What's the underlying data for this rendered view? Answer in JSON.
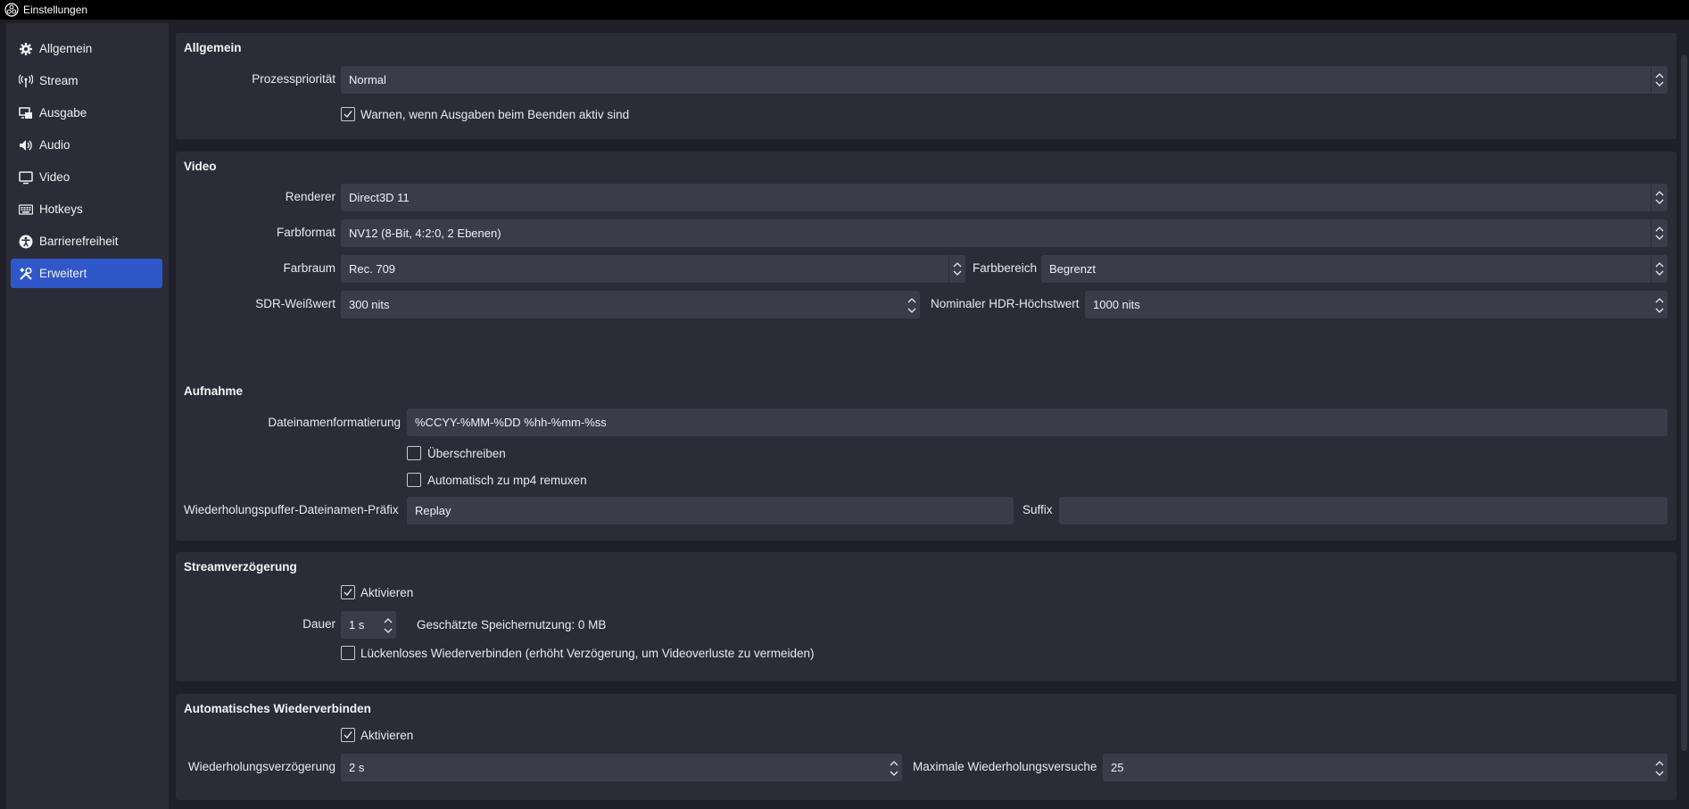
{
  "window": {
    "title": "Einstellungen"
  },
  "sidebar": {
    "items": [
      {
        "label": "Allgemein",
        "icon": "gear-icon"
      },
      {
        "label": "Stream",
        "icon": "antenna-icon"
      },
      {
        "label": "Ausgabe",
        "icon": "output-icon"
      },
      {
        "label": "Audio",
        "icon": "speaker-icon"
      },
      {
        "label": "Video",
        "icon": "monitor-icon"
      },
      {
        "label": "Hotkeys",
        "icon": "keyboard-icon"
      },
      {
        "label": "Barrierefreiheit",
        "icon": "accessibility-icon"
      },
      {
        "label": "Erweitert",
        "icon": "tools-icon",
        "active": true
      }
    ],
    "accent_color": "#2f57c7"
  },
  "general": {
    "title": "Allgemein",
    "priority_label": "Prozesspriorität",
    "priority_value": "Normal",
    "warn_label": "Warnen, wenn Ausgaben beim Beenden aktiv sind",
    "warn_checked": true
  },
  "video": {
    "title": "Video",
    "renderer_label": "Renderer",
    "renderer_value": "Direct3D 11",
    "color_format_label": "Farbformat",
    "color_format_value": "NV12 (8-Bit, 4:2:0, 2 Ebenen)",
    "color_space_label": "Farbraum",
    "color_space_value": "Rec. 709",
    "color_range_label": "Farbbereich",
    "color_range_value": "Begrenzt",
    "sdr_label": "SDR-Weißwert",
    "sdr_value": "300 nits",
    "hdr_label": "Nominaler HDR-Höchstwert",
    "hdr_value": "1000 nits"
  },
  "recording": {
    "title": "Aufnahme",
    "filename_label": "Dateinamenformatierung",
    "filename_value": "%CCYY-%MM-%DD %hh-%mm-%ss",
    "overwrite_label": "Überschreiben",
    "overwrite_checked": false,
    "remux_label": "Automatisch zu mp4 remuxen",
    "remux_checked": false,
    "replay_prefix_label": "Wiederholungspuffer-Dateinamen-Präfix",
    "replay_prefix_value": "Replay",
    "suffix_label": "Suffix",
    "suffix_value": ""
  },
  "stream_delay": {
    "title": "Streamverzögerung",
    "enable_label": "Aktivieren",
    "enable_checked": true,
    "duration_label": "Dauer",
    "duration_value": "1 s",
    "memory_text": "Geschätzte Speichernutzung: 0 MB",
    "preserve_label": "Lückenloses Wiederverbinden (erhöht Verzögerung, um Videoverluste zu vermeiden)",
    "preserve_checked": false
  },
  "reconnect": {
    "title": "Automatisches Wiederverbinden",
    "enable_label": "Aktivieren",
    "enable_checked": true,
    "retry_delay_label": "Wiederholungsverzögerung",
    "retry_delay_value": "2 s",
    "max_retries_label": "Maximale Wiederholungsversuche",
    "max_retries_value": "25"
  }
}
